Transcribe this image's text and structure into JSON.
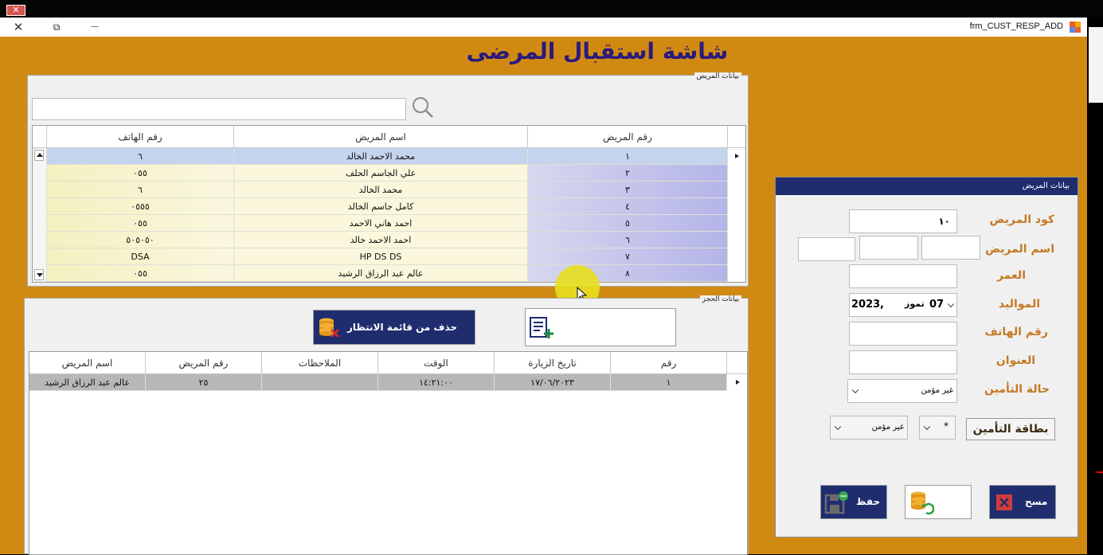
{
  "titlebar": {
    "title": "frm_CUST_RESP_ADD",
    "close_glyph": "✕",
    "restore_glyph": "⧉",
    "minimize_glyph": "—",
    "top_close_glyph": "✕"
  },
  "page_title": "شاشة استقبال المرضى",
  "patients_group": {
    "caption": "بيانات المريض",
    "search": {
      "value": "",
      "placeholder": ""
    },
    "columns": [
      "رقم المريض",
      "اسم المريض",
      "رقم الهاتف"
    ],
    "rows": [
      {
        "id": "١",
        "name": "محمد الاحمد الخالد",
        "phone": "٦"
      },
      {
        "id": "٢",
        "name": "علي الجاسم الحلف",
        "phone": "٠٥٥"
      },
      {
        "id": "٣",
        "name": "محمد الخالد",
        "phone": "٦"
      },
      {
        "id": "٤",
        "name": "كامل جاسم الخالد",
        "phone": "٠٥٥٥"
      },
      {
        "id": "٥",
        "name": "احمد هاني الاحمد",
        "phone": "٠٥٥"
      },
      {
        "id": "٦",
        "name": "احمد الاحمد خالد",
        "phone": "٥٠٥٠٥٠"
      },
      {
        "id": "٧",
        "name": "HP DS DS",
        "phone": "DSA"
      },
      {
        "id": "٨",
        "name": "عالم عبد الرزاق الرشيد",
        "phone": "٠٥٥"
      }
    ]
  },
  "booking_group": {
    "caption": "بيانات الحجز",
    "remove_button": "حذف من قائمة الانتظار",
    "columns": [
      "رقم",
      "تاريخ الزيارة",
      "الوقت",
      "الملاحظات",
      "رقم المريض",
      "اسم المريض"
    ],
    "rows": [
      {
        "no": "١",
        "date": "١٧/٠٦/٢٠٢٣",
        "time": "١٤:٢١:٠٠",
        "notes": "",
        "patient_id": "٢٥",
        "patient_name": "عالم عبد الرزاق الرشيد"
      }
    ]
  },
  "side_panel": {
    "header": "بيانات المريض",
    "labels": {
      "code": "كود المريض",
      "name": "اسم المريض",
      "age": "العمر",
      "birth": "المواليد",
      "phone": "رقم الهاتف",
      "address": "العنوان",
      "insurance": "حالة التأمين"
    },
    "values": {
      "code": "١٠",
      "name1": "",
      "name2": "",
      "name3": "",
      "age": "",
      "phone": "",
      "address": "",
      "birth_day": "07",
      "birth_month": "تموز",
      "birth_year": "2023",
      "birth_sep": ",",
      "insurance_status": "غير مؤمن"
    },
    "insurance_card_button": "بطاقة التأمين",
    "card_combo_1": "غير مؤمن",
    "card_combo_2": "*",
    "save_button": "حفظ",
    "delete_button": "مسح"
  }
}
